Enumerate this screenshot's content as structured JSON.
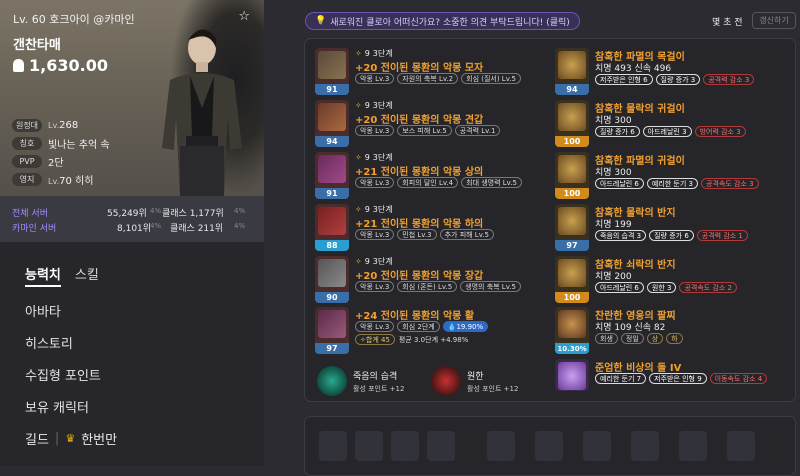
{
  "character": {
    "level_server": "Lv. 60 호크아이 @카마인",
    "nickname": "갠찬타매",
    "power": "1,630.00",
    "rows": [
      {
        "tag": "원정대",
        "value_prefix": "Lv.",
        "value": "268"
      },
      {
        "tag": "칭호",
        "value_prefix": "",
        "value": "빛나는 추억 속"
      },
      {
        "tag": "PVP",
        "value_prefix": "",
        "value": "2단"
      },
      {
        "tag": "영지",
        "value_prefix": "Lv.",
        "value": "70 히히"
      }
    ]
  },
  "ranking": {
    "all_label": "전체 서버",
    "all_rank": "55,249위",
    "all_pct": "4%",
    "all_class": "클래스 1,177위",
    "all_class_pct": "4%",
    "server_label": "카마인 서버",
    "server_rank": "8,101위",
    "server_pct": "4%",
    "server_class": "클래스 211위",
    "server_class_pct": "4%"
  },
  "menu": {
    "tab_stats": "능력치",
    "tab_skills": "스킬",
    "items": [
      "아바타",
      "히스토리",
      "수집형 포인트",
      "보유 캐릭터"
    ],
    "guild_label": "길드",
    "guild_name": "한번만"
  },
  "notice": "새로워진 클로아 어떠신가요? 소중한 의견 부탁드립니다! (클릭)",
  "time_ago": "몇 초 전",
  "refresh": "갱신하기",
  "equipment": [
    {
      "badge": "91",
      "stage": "9",
      "stage_label": "3단계",
      "name": "+20 전이된 몽환의 악몽 모자",
      "chips": [
        "악몽 Lv.3",
        "자원의 축복 Lv.2",
        "회심 (질서) Lv.5"
      ]
    },
    {
      "badge": "94",
      "stage": "9",
      "stage_label": "3단계",
      "name": "+20 전이된 몽환의 악몽 견갑",
      "chips": [
        "악몽 Lv.3",
        "보스 피해 Lv.5",
        "공격력 Lv.1"
      ]
    },
    {
      "badge": "91",
      "stage": "9",
      "stage_label": "3단계",
      "name": "+21 전이된 몽환의 악몽 상의",
      "chips": [
        "악몽 Lv.3",
        "회피의 달인 Lv.4",
        "최대 생명력 Lv.5"
      ]
    },
    {
      "badge": "88",
      "stage": "9",
      "stage_label": "3단계",
      "name": "+21 전이된 몽환의 악몽 하의",
      "chips": [
        "악몽 Lv.3",
        "민첩 Lv.3",
        "추가 피해 Lv.5"
      ]
    },
    {
      "badge": "90",
      "stage": "9",
      "stage_label": "3단계",
      "name": "+20 전이된 몽환의 악몽 장갑",
      "chips": [
        "악몽 Lv.3",
        "회심 (혼돈) Lv.5",
        "생명의 축복 Lv.5"
      ]
    },
    {
      "badge": "97",
      "name": "+24 전이된 몽환의 악몽 활",
      "chips": [
        "악몽 Lv.3",
        "회심 2단계"
      ],
      "blue_chip": "19.90%",
      "sum_label": "합계 45",
      "avg_text": "평균 3.0단계 +4.98%"
    }
  ],
  "accessories": [
    {
      "badge": "94",
      "name": "참혹한 파멸의 목걸이",
      "stats": "치명 493  신속 496",
      "chips": [
        "저주받은 인형 6",
        "질량 증가 3"
      ],
      "red_chip": "공격력 감소 3"
    },
    {
      "badge": "100",
      "name": "참혹한 몰락의 귀걸이",
      "stats": "치명 300",
      "chips": [
        "질량 증가 6",
        "아드레날린 3"
      ],
      "red_chip": "방어력 감소 3"
    },
    {
      "badge": "100",
      "name": "참혹한 파멸의 귀걸이",
      "stats": "치명 300",
      "chips": [
        "아드레날린 6",
        "예리한 둔기 3"
      ],
      "red_chip": "공격속도 감소 3"
    },
    {
      "badge": "97",
      "name": "참혹한 몰락의 반지",
      "stats": "치명 199",
      "chips": [
        "죽음의 습격 3",
        "질량 증가 6"
      ],
      "red_chip": "공격력 감소 1"
    },
    {
      "badge": "100",
      "name": "참혹한 쇠락의 반지",
      "stats": "치명 200",
      "chips": [
        "아드레날린 6",
        "원한 3"
      ],
      "red_chip": "공격속도 감소 2"
    },
    {
      "badge": "10.30%",
      "name": "찬란한 영웅의 팔찌",
      "stats": "치명 109  신속 82",
      "chips": [
        "회생",
        "정일"
      ],
      "gold_chip": "상",
      "gold_chip2": "하"
    },
    {
      "name": "준엄한 비상의 돌 IV",
      "chips": [
        "예리한 둔기 7",
        "저주받은 인형 9"
      ],
      "red_chip": "이동속도 감소 4"
    }
  ],
  "engravings": [
    {
      "name": "죽음의 습격",
      "points": "활성 포인트 +12"
    },
    {
      "name": "원한",
      "points": "활성 포인트 +12"
    }
  ],
  "colors": {
    "accent": "#f0a030",
    "rank": "#a48cff",
    "negative": "#ff6b6b",
    "quality_blue": "#3a6ea8",
    "quality_orange": "#d18a1c"
  }
}
